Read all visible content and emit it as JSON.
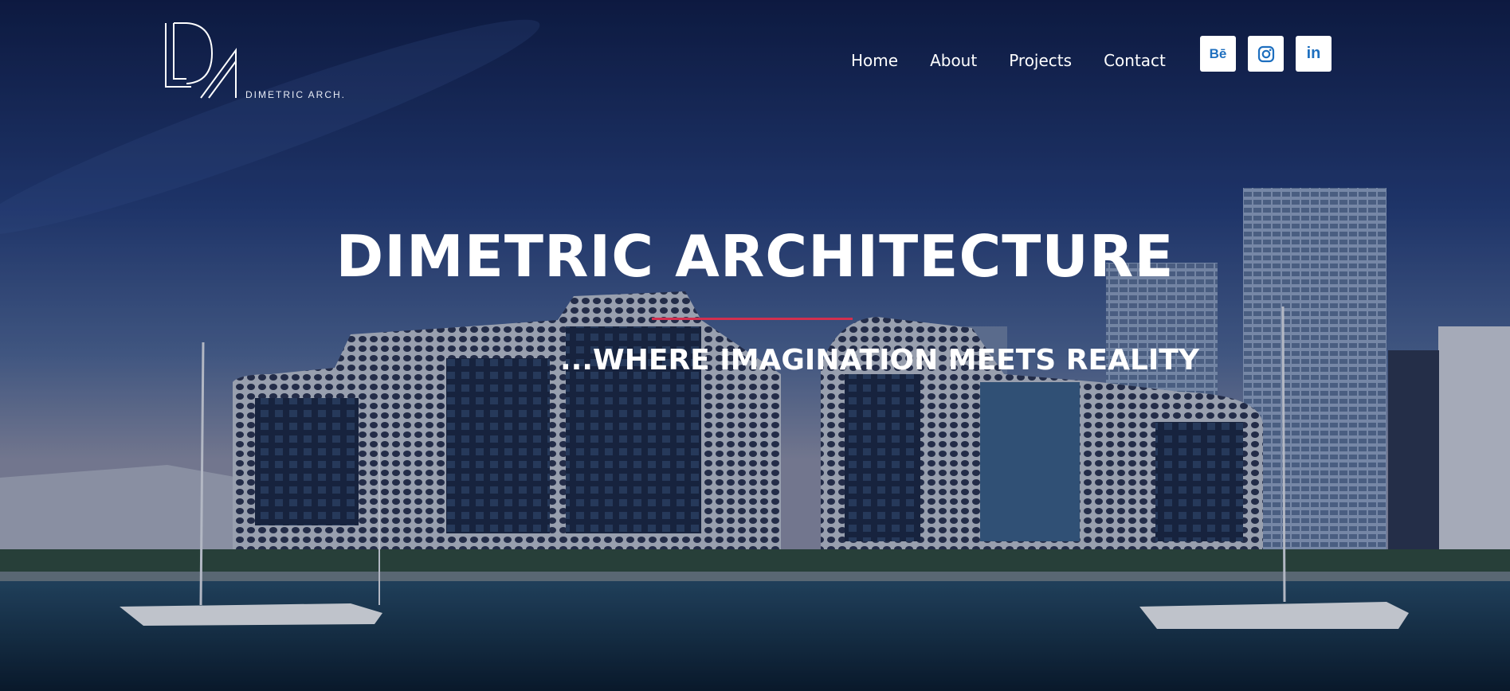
{
  "brand": {
    "logo_monogram": "DA",
    "logo_caption": "DIMETRIC ARCH."
  },
  "nav": {
    "items": [
      {
        "label": "Home"
      },
      {
        "label": "About"
      },
      {
        "label": "Projects"
      },
      {
        "label": "Contact"
      }
    ]
  },
  "social": {
    "behance_label": "Bē",
    "linkedin_label": "in",
    "icons": [
      "behance-icon",
      "instagram-icon",
      "linkedin-icon"
    ],
    "icon_color": "#1e6fbf"
  },
  "hero": {
    "title": "DIMETRIC ARCHITECTURE",
    "tagline": "...WHERE IMAGINATION MEETS REALITY",
    "divider_color": "#d32f4f"
  }
}
